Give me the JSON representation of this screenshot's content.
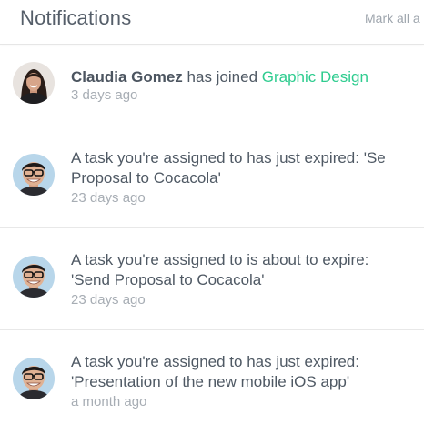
{
  "header": {
    "title": "Notifications",
    "mark_all_label": "Mark all a"
  },
  "colors": {
    "accent_green": "#2ecc8f",
    "text": "#4f5964",
    "muted": "#a7adb4"
  },
  "notifications": [
    {
      "avatar": "woman-avatar",
      "actor": "Claudia Gomez",
      "action": " has joined ",
      "target": "Graphic Design",
      "time": "3 days ago"
    },
    {
      "avatar": "man-glasses-avatar",
      "line1": "A task you're assigned to has just expired: 'Se",
      "line2": "Proposal to Cocacola'",
      "time": "23 days ago"
    },
    {
      "avatar": "man-glasses-avatar",
      "line1": "A task you're assigned to is about to expire:",
      "line2": "'Send Proposal to Cocacola'",
      "time": "23 days ago"
    },
    {
      "avatar": "man-glasses-avatar",
      "line1": "A task you're assigned to has just expired:",
      "line2": "'Presentation of the new mobile iOS app'",
      "time": "a month ago"
    }
  ]
}
